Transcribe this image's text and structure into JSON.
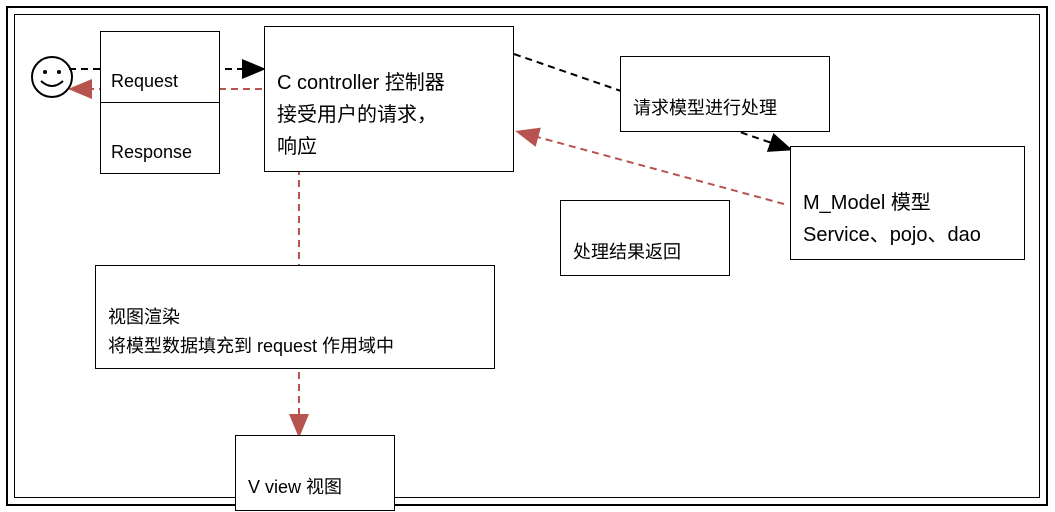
{
  "boxes": {
    "request": "Request",
    "response": "Response",
    "controller": "C controller 控制器\n接受用户的请求，\n响应",
    "model_request": "请求模型进行处理",
    "model": "M_Model 模型\nService、pojo、dao",
    "model_return": "处理结果返回",
    "view_render": "视图渲染\n将模型数据填充到 request 作用域中",
    "view": "V view  视图"
  }
}
